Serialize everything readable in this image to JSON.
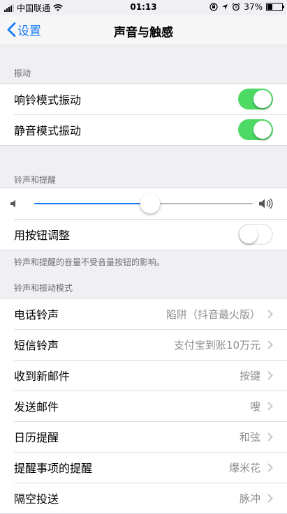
{
  "status_bar": {
    "carrier": "中国联通",
    "time": "01:13",
    "battery_percent": "37%",
    "battery_level": 0.37,
    "icons": [
      "signal-icon",
      "wifi-icon",
      "lock-rotation-icon",
      "location-icon",
      "alarm-icon",
      "battery-icon"
    ]
  },
  "nav": {
    "back_label": "设置",
    "title": "声音与触感"
  },
  "vibrate": {
    "header": "振动",
    "rows": [
      {
        "label": "响铃模式振动",
        "on": true
      },
      {
        "label": "静音模式振动",
        "on": true
      }
    ]
  },
  "ringer": {
    "header": "铃声和提醒",
    "volume_level": 0.53,
    "change_with_buttons_label": "用按钮调整",
    "change_with_buttons_on": false,
    "footer": "铃声和提醒的音量不受音量按钮的影响。"
  },
  "patterns": {
    "header": "铃声和振动模式",
    "rows": [
      {
        "label": "电话铃声",
        "value": "陷阱（抖音最火版）"
      },
      {
        "label": "短信铃声",
        "value": "支付宝到账10万元"
      },
      {
        "label": "收到新邮件",
        "value": "按键"
      },
      {
        "label": "发送邮件",
        "value": "嗖"
      },
      {
        "label": "日历提醒",
        "value": "和弦"
      },
      {
        "label": "提醒事项的提醒",
        "value": "爆米花"
      },
      {
        "label": "隔空投送",
        "value": "脉冲"
      }
    ]
  },
  "colors": {
    "accent": "#1a7cf5",
    "toggle_on": "#4cd964",
    "background": "#efeff4"
  }
}
